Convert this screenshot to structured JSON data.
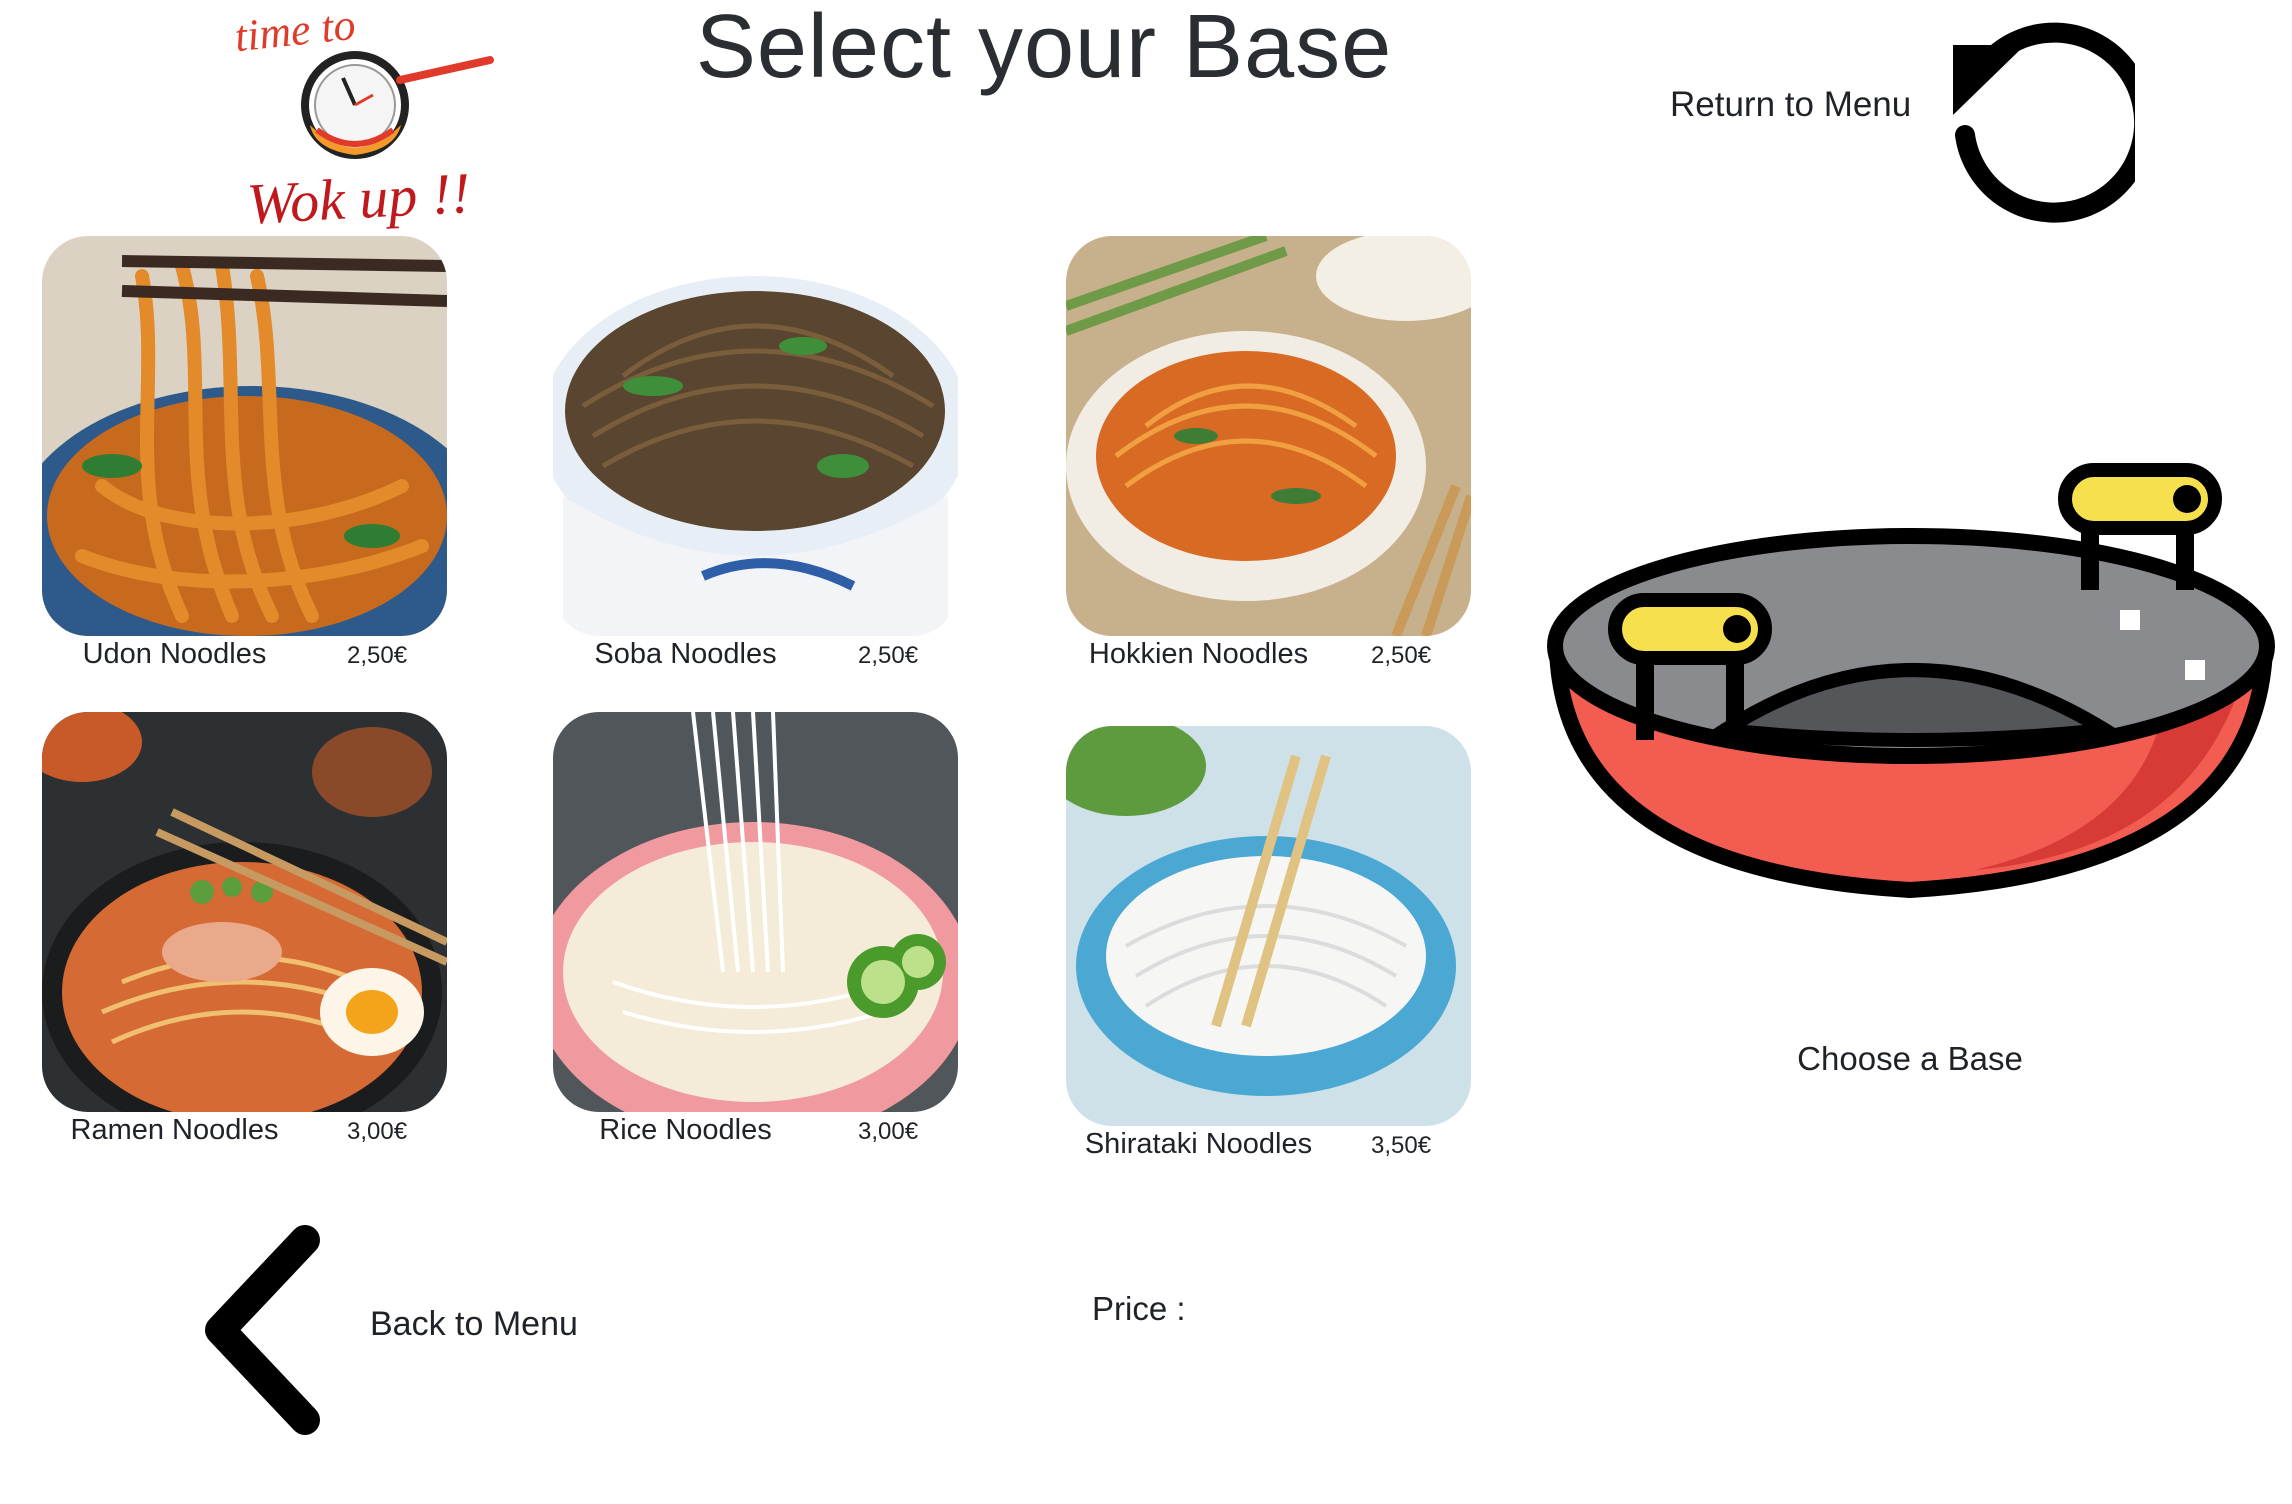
{
  "logo": {
    "line1": "time to",
    "line2": "Wok up !!"
  },
  "title": "Select your Base",
  "return_label": "Return to Menu",
  "items": [
    {
      "name": "Udon Noodles",
      "price": "2,50€"
    },
    {
      "name": "Soba Noodles",
      "price": "2,50€"
    },
    {
      "name": "Hokkien Noodles",
      "price": "2,50€"
    },
    {
      "name": "Ramen Noodles",
      "price": "3,00€"
    },
    {
      "name": "Rice Noodles",
      "price": "3,00€"
    },
    {
      "name": "Shirataki Noodles",
      "price": "3,50€"
    }
  ],
  "choose_label": "Choose a Base",
  "back_label": "Back to Menu",
  "price_label": "Price :",
  "colors": {
    "wok_red": "#f35c50",
    "wok_grey": "#8a8b8e",
    "handle_yellow": "#f7e04e",
    "logo_red": "#e03b2a"
  },
  "icons": {
    "return": "rotate-ccw-icon",
    "back": "chevron-left-icon",
    "wok": "wok-icon"
  }
}
